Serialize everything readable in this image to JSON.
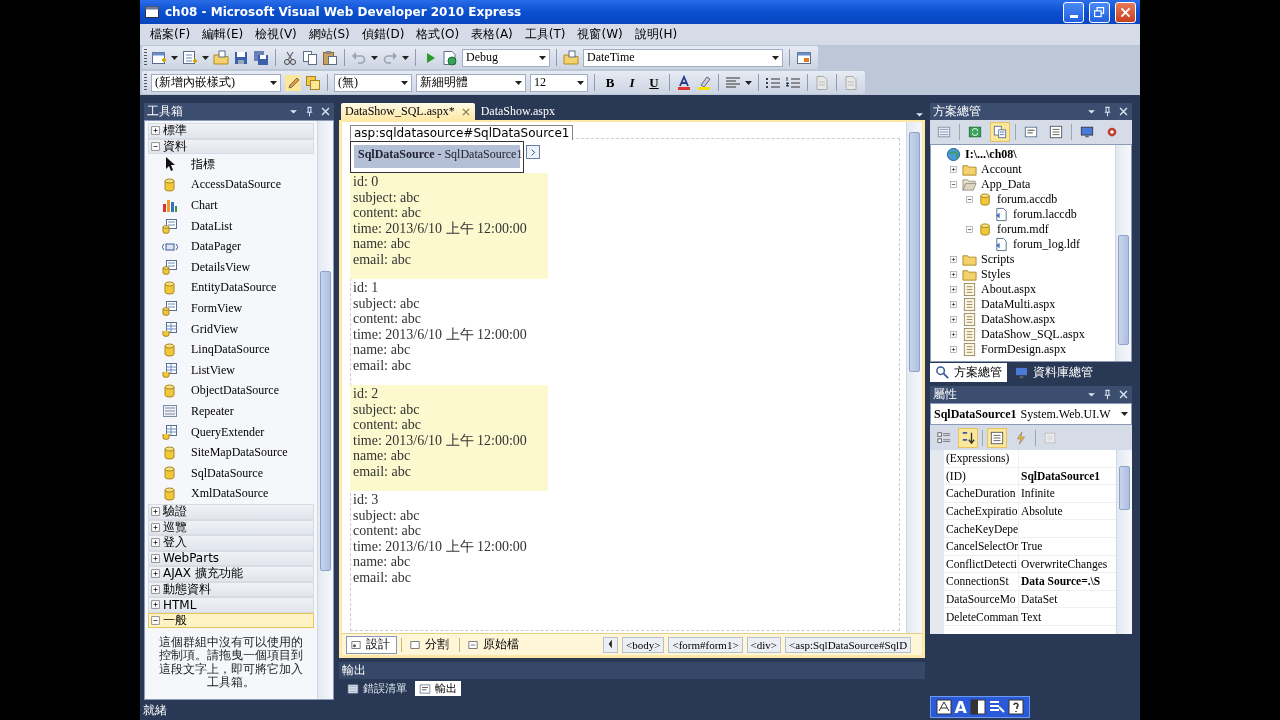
{
  "window": {
    "title": "ch08 - Microsoft Visual Web Developer 2010 Express"
  },
  "menu": [
    "檔案(F)",
    "編輯(E)",
    "檢視(V)",
    "網站(S)",
    "偵錯(D)",
    "格式(O)",
    "表格(A)",
    "工具(T)",
    "視窗(W)",
    "說明(H)"
  ],
  "toolbars": [
    {
      "items": [
        {
          "kind": "icon"
        },
        {
          "kind": "caret"
        },
        {
          "kind": "icon"
        },
        {
          "kind": "caret"
        },
        {
          "kind": "icon"
        },
        {
          "kind": "icon"
        },
        {
          "kind": "icon"
        },
        {
          "kind": "sep"
        },
        {
          "kind": "icon"
        },
        {
          "kind": "icon"
        },
        {
          "kind": "icon"
        },
        {
          "kind": "sep"
        },
        {
          "kind": "icon"
        },
        {
          "kind": "caret"
        },
        {
          "kind": "icon"
        },
        {
          "kind": "caret"
        },
        {
          "kind": "sep"
        },
        {
          "kind": "icon"
        },
        {
          "kind": "icon"
        },
        {
          "kind": "combo",
          "value": "Debug"
        },
        {
          "kind": "sep"
        },
        {
          "kind": "icon"
        },
        {
          "kind": "combo",
          "value": "DateTime"
        },
        {
          "kind": "sep"
        },
        {
          "kind": "icon"
        }
      ]
    },
    {
      "items": [
        {
          "kind": "combo",
          "value": "(新增內嵌樣式)"
        },
        {
          "kind": "icon"
        },
        {
          "kind": "icon"
        },
        {
          "kind": "sep"
        },
        {
          "kind": "combo",
          "value": "(無)"
        },
        {
          "kind": "combo",
          "value": "新細明體"
        },
        {
          "kind": "combo",
          "value": "12"
        },
        {
          "kind": "sep"
        },
        {
          "kind": "letter",
          "value": "B"
        },
        {
          "kind": "letter",
          "value": "I"
        },
        {
          "kind": "letter",
          "value": "U"
        },
        {
          "kind": "sep"
        },
        {
          "kind": "icon"
        },
        {
          "kind": "icon"
        },
        {
          "kind": "sep"
        },
        {
          "kind": "icon"
        },
        {
          "kind": "caret"
        },
        {
          "kind": "sep"
        },
        {
          "kind": "icon"
        },
        {
          "kind": "icon"
        },
        {
          "kind": "sep"
        },
        {
          "kind": "icon"
        },
        {
          "kind": "sep"
        },
        {
          "kind": "icon"
        }
      ]
    }
  ],
  "toolbox": {
    "title": "工具箱",
    "groups": [
      {
        "label": "標準",
        "expanded": false,
        "selected": false
      },
      {
        "label": "資料",
        "expanded": true,
        "selected": false,
        "items": [
          {
            "label": "指標",
            "kind": "pointer"
          },
          {
            "label": "AccessDataSource",
            "kind": "database"
          },
          {
            "label": "Chart",
            "kind": "chart"
          },
          {
            "label": "DataList",
            "kind": "form"
          },
          {
            "label": "DataPager",
            "kind": "pager"
          },
          {
            "label": "DetailsView",
            "kind": "form"
          },
          {
            "label": "EntityDataSource",
            "kind": "database"
          },
          {
            "label": "FormView",
            "kind": "form"
          },
          {
            "label": "GridView",
            "kind": "grid"
          },
          {
            "label": "LinqDataSource",
            "kind": "database"
          },
          {
            "label": "ListView",
            "kind": "grid"
          },
          {
            "label": "ObjectDataSource",
            "kind": "database"
          },
          {
            "label": "Repeater",
            "kind": "list"
          },
          {
            "label": "QueryExtender",
            "kind": "grid"
          },
          {
            "label": "SiteMapDataSource",
            "kind": "database"
          },
          {
            "label": "SqlDataSource",
            "kind": "database"
          },
          {
            "label": "XmlDataSource",
            "kind": "database"
          }
        ]
      },
      {
        "label": "驗證",
        "expanded": false,
        "selected": false
      },
      {
        "label": "巡覽",
        "expanded": false,
        "selected": false
      },
      {
        "label": "登入",
        "expanded": false,
        "selected": false
      },
      {
        "label": "WebParts",
        "expanded": false,
        "selected": false
      },
      {
        "label": "AJAX 擴充功能",
        "expanded": false,
        "selected": false
      },
      {
        "label": "動態資料",
        "expanded": false,
        "selected": false
      },
      {
        "label": "HTML",
        "expanded": false,
        "selected": false
      },
      {
        "label": "一般",
        "expanded": true,
        "selected": true,
        "empty_message": "這個群組中沒有可以使用的控制項。請拖曳一個項目到這段文字上，即可將它加入工具箱。"
      }
    ]
  },
  "designer": {
    "tabs": [
      {
        "label": "DataShow_SQL.aspx*",
        "selected": true
      },
      {
        "label": "DataShow.aspx",
        "selected": false
      }
    ],
    "tag_label": "asp:sqldatasource#SqlDataSource1",
    "control_label": "**SqlDataSource** - SqlDataSource1",
    "records": [
      {
        "highlighted": true,
        "lines": [
          "id: 0",
          "subject: abc",
          "content: abc",
          "time: 2013/6/10 上午 12:00:00",
          "name: abc",
          "email: abc"
        ]
      },
      {
        "highlighted": false,
        "lines": [
          "id: 1",
          "subject: abc",
          "content: abc",
          "time: 2013/6/10 上午 12:00:00",
          "name: abc",
          "email: abc"
        ]
      },
      {
        "highlighted": true,
        "lines": [
          "id: 2",
          "subject: abc",
          "content: abc",
          "time: 2013/6/10 上午 12:00:00",
          "name: abc",
          "email: abc"
        ]
      },
      {
        "highlighted": false,
        "lines": [
          "id: 3",
          "subject: abc",
          "content: abc",
          "time: 2013/6/10 上午 12:00:00",
          "name: abc",
          "email: abc"
        ]
      }
    ],
    "view_tabs": [
      {
        "label": "設計",
        "selected": true
      },
      {
        "label": "分割",
        "selected": false
      },
      {
        "label": "原始檔",
        "selected": false
      }
    ],
    "breadcrumbs": [
      "<body>",
      "<form#form1>",
      "<div>",
      "<asp:SqlDataSource#SqlD"
    ]
  },
  "output": {
    "title": "輸出",
    "tabs": [
      {
        "label": "錯誤清單",
        "selected": false
      },
      {
        "label": "輸出",
        "selected": true
      }
    ]
  },
  "solution": {
    "title": "方案總管",
    "toolbar": [
      {
        "selected": false
      },
      {
        "selected": false
      },
      {
        "selected": true
      },
      {
        "selected": false
      },
      {
        "selected": false
      },
      {
        "selected": false
      },
      {
        "selected": false
      }
    ],
    "tree": [
      {
        "label": "I:\\...\\ch08\\",
        "kind": "project",
        "children": [
          {
            "label": "Account",
            "kind": "folder",
            "expanded": false
          },
          {
            "label": "App_Data",
            "kind": "folder",
            "expanded": true,
            "children": [
              {
                "label": "forum.accdb",
                "kind": "database",
                "expanded": true,
                "children": [
                  {
                    "label": "forum.laccdb",
                    "kind": "file"
                  }
                ]
              },
              {
                "label": "forum.mdf",
                "kind": "database",
                "expanded": true,
                "children": [
                  {
                    "label": "forum_log.ldf",
                    "kind": "file"
                  }
                ]
              }
            ]
          },
          {
            "label": "Scripts",
            "kind": "folder",
            "expanded": false
          },
          {
            "label": "Styles",
            "kind": "folder",
            "expanded": false
          },
          {
            "label": "About.aspx",
            "kind": "page",
            "expanded": false
          },
          {
            "label": "DataMulti.aspx",
            "kind": "page",
            "expanded": false
          },
          {
            "label": "DataShow.aspx",
            "kind": "page",
            "expanded": false
          },
          {
            "label": "DataShow_SQL.aspx",
            "kind": "page",
            "expanded": false
          },
          {
            "label": "FormDesign.aspx",
            "kind": "page",
            "expanded": false
          }
        ]
      }
    ],
    "tabs": [
      {
        "label": "方案總管",
        "selected": true
      },
      {
        "label": "資料庫總管",
        "selected": false
      }
    ]
  },
  "properties": {
    "title": "屬性",
    "object": "SqlDataSource1",
    "object_type": "System.Web.UI.W",
    "toolbar": [
      {
        "selected": false
      },
      {
        "selected": true
      },
      {
        "selected": true
      },
      {
        "selected": false
      },
      {
        "selected": false
      }
    ],
    "rows": [
      {
        "name": "(Expressions)"
      },
      {
        "name": "(ID)",
        "value": "SqlDataSource1",
        "bold": true
      },
      {
        "name": "CacheDuration",
        "value": "Infinite",
        "bold": false
      },
      {
        "name": "CacheExpiratio",
        "value": "Absolute",
        "bold": false
      },
      {
        "name": "CacheKeyDepe"
      },
      {
        "name": "CancelSelectOr",
        "value": "True",
        "bold": false
      },
      {
        "name": "ConflictDetecti",
        "value": "OverwriteChanges",
        "bold": false
      },
      {
        "name": "ConnectionSt",
        "value": "Data Source=.\\S",
        "bold": true
      },
      {
        "name": "DataSourceMo",
        "value": "DataSet",
        "bold": false
      },
      {
        "name": "DeleteComman",
        "value": "Text",
        "bold": false
      }
    ]
  },
  "status_bar": {
    "text": "就緒"
  },
  "language_bar": {
    "letter": "A"
  }
}
